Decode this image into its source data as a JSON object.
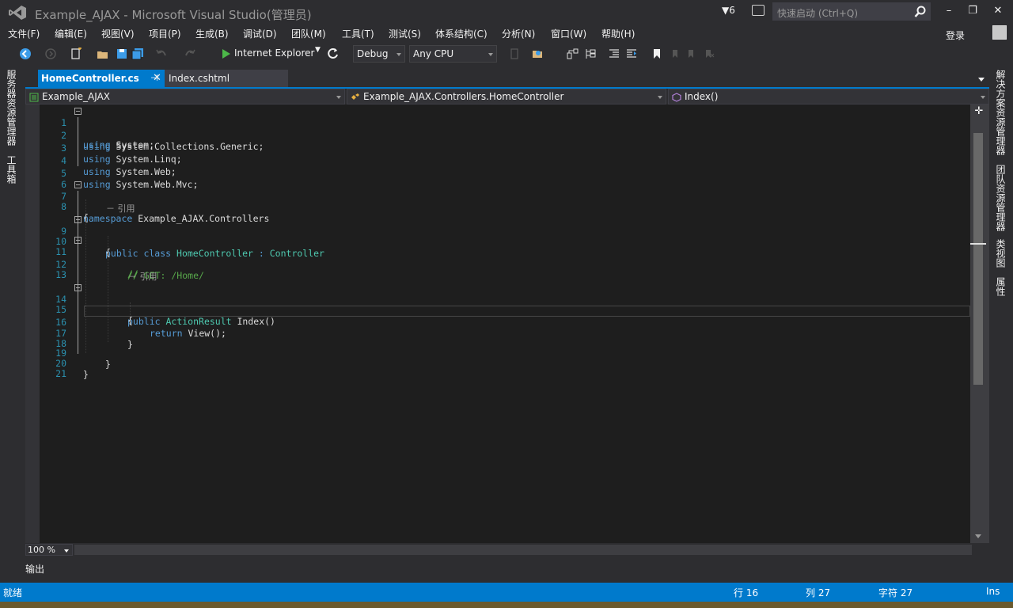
{
  "window": {
    "title": "Example_AJAX - Microsoft Visual Studio(管理员)",
    "notification_count": "6",
    "quick_launch_placeholder": "快速启动 (Ctrl+Q)",
    "login_label": "登录",
    "minimize": "–",
    "restore": "❐",
    "close": "✕"
  },
  "menu": [
    "文件(F)",
    "编辑(E)",
    "视图(V)",
    "项目(P)",
    "生成(B)",
    "调试(D)",
    "团队(M)",
    "工具(T)",
    "测试(S)",
    "体系结构(C)",
    "分析(N)",
    "窗口(W)",
    "帮助(H)"
  ],
  "toolbar": {
    "run_target": "Internet Explorer",
    "configuration": "Debug",
    "platform": "Any CPU"
  },
  "left_tabs": [
    "服务器资源管理器",
    "工具箱"
  ],
  "right_tabs": [
    "解决方案资源管理器",
    "团队资源管理器",
    "类视图",
    "属性"
  ],
  "tabs": {
    "active": "HomeController.cs",
    "active_pin": "⊣",
    "inactive": "Index.cshtml",
    "inactive_close": "✕"
  },
  "navbar": {
    "project": "Example_AJAX",
    "type": "Example_AJAX.Controllers.HomeController",
    "member": "Index()"
  },
  "code": {
    "line_numbers": [
      "1",
      "2",
      "3",
      "4",
      "5",
      "6",
      "7",
      "8",
      "9",
      "10",
      "11",
      "12",
      "13",
      "14",
      "15",
      "16",
      "17",
      "18",
      "19",
      "20",
      "21"
    ],
    "ref_label": "－ 引用",
    "l1_kw": "using",
    "l1_rest": " System;",
    "l2_kw": "using",
    "l2_rest": " System.Collections.Generic;",
    "l3_kw": "using",
    "l3_rest": " System.Linq;",
    "l4_kw": "using",
    "l4_rest": " System.Web;",
    "l5_kw": "using",
    "l5_rest": " System.Web.Mvc;",
    "l7_kw": "namespace",
    "l7_rest": " Example_AJAX.Controllers",
    "brace_open": "{",
    "brace_close": "}",
    "l9_kw": "public class",
    "l9_type": "HomeController",
    "l9_colon": " : ",
    "l9_base": "Controller",
    "l11_comment": "//",
    "l12_comment": "// GET: /Home/",
    "l14_kw": "public",
    "l14_type": "ActionResult",
    "l14_rest": " Index()",
    "l16_kw": "return",
    "l16_rest": " View();"
  },
  "zoom": "100 %",
  "output_label": "输出",
  "status": {
    "ready": "就绪",
    "line": "行 16",
    "col": "列 27",
    "char": "字符 27",
    "mode": "Ins"
  },
  "colors": {
    "accent": "#007acc",
    "editor_bg": "#1e1e1e",
    "keyword": "#569cd6",
    "type": "#4ec9b0",
    "comment": "#57a64a",
    "line_number": "#2b91af"
  }
}
